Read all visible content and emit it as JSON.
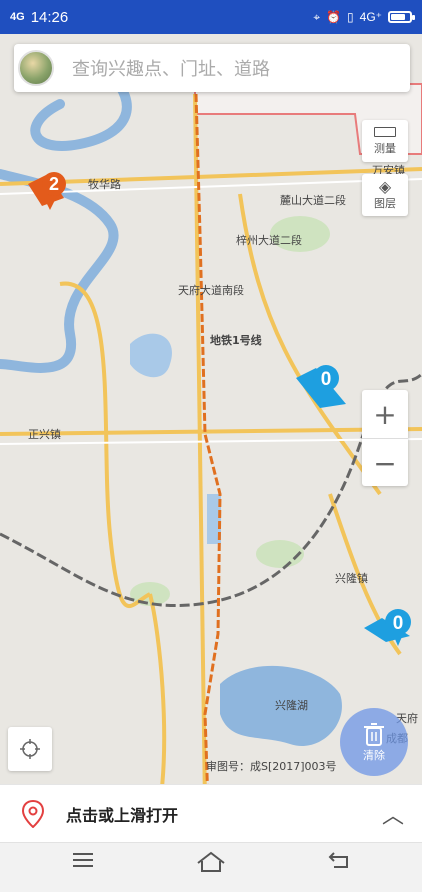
{
  "status_bar": {
    "signal": "4G",
    "time": "14:26",
    "network": "4G⁺"
  },
  "search": {
    "placeholder": "查询兴趣点、门址、道路"
  },
  "tools": {
    "measure": "测量",
    "layers": "图层"
  },
  "markers": [
    {
      "count": "2",
      "color": "#e35b1b"
    },
    {
      "count": "0",
      "color": "#1e9fe0"
    },
    {
      "count": "0",
      "color": "#1e9fe0"
    }
  ],
  "map_labels": {
    "muhua_road": "牧华路",
    "tianfu_avenue_south": "天府大道南段",
    "metro_line1": "地铁1号线",
    "zhengxing_town": "正兴镇",
    "xinglong_town": "兴隆镇",
    "xinglong_lake": "兴隆湖",
    "wananzhen": "万安镇",
    "zizhou_avenue": "梓州大道二段",
    "luhu_avenue": "麓山大道二段",
    "east_edge": "天府",
    "east_edge2": "成都",
    "copyright": "审图号：成S[2017]003号"
  },
  "zoom": {
    "in": "+",
    "out": "−"
  },
  "clear_button": {
    "label": "清除"
  },
  "bottom_panel": {
    "label": "点击或上滑打开",
    "arrow": "︿"
  },
  "colors": {
    "status": "#1f4fbf",
    "metro": "#e07020",
    "water": "#8fb6dd",
    "road": "#f2c45a"
  }
}
